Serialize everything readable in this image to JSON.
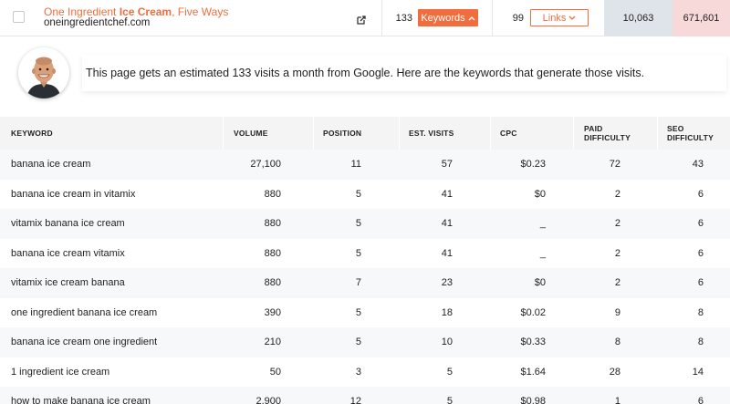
{
  "result": {
    "title_prefix": "One Ingredient ",
    "title_bold": "Ice Cream",
    "title_suffix": ", Five Ways",
    "domain": "oneingredientchef.com",
    "keyword_count": "133",
    "keywords_button": "Keywords",
    "backlink_count": "99",
    "links_button": "Links",
    "est_visits": "10,063",
    "shares": "671,601",
    "accent_color": "#f26d3d"
  },
  "banner": {
    "text": "This page gets an estimated 133 visits a month from Google. Here are the keywords that generate those visits."
  },
  "table": {
    "headers": {
      "keyword": "KEYWORD",
      "volume": "VOLUME",
      "position": "POSITION",
      "est_visits": "EST. VISITS",
      "cpc": "CPC",
      "paid_difficulty_1": "PAID",
      "paid_difficulty_2": "DIFFICULTY",
      "seo_difficulty_1": "SEO",
      "seo_difficulty_2": "DIFFICULTY"
    },
    "rows": [
      {
        "keyword": "banana ice cream",
        "volume": "27,100",
        "position": "11",
        "visits": "57",
        "cpc": "$0.23",
        "paid": "72",
        "seo": "43"
      },
      {
        "keyword": "banana ice cream in vitamix",
        "volume": "880",
        "position": "5",
        "visits": "41",
        "cpc": "$0",
        "paid": "2",
        "seo": "6"
      },
      {
        "keyword": "vitamix banana ice cream",
        "volume": "880",
        "position": "5",
        "visits": "41",
        "cpc": "_",
        "paid": "2",
        "seo": "6"
      },
      {
        "keyword": "banana ice cream vitamix",
        "volume": "880",
        "position": "5",
        "visits": "41",
        "cpc": "_",
        "paid": "2",
        "seo": "6"
      },
      {
        "keyword": "vitamix ice cream banana",
        "volume": "880",
        "position": "7",
        "visits": "23",
        "cpc": "$0",
        "paid": "2",
        "seo": "6"
      },
      {
        "keyword": "one ingredient banana ice cream",
        "volume": "390",
        "position": "5",
        "visits": "18",
        "cpc": "$0.02",
        "paid": "9",
        "seo": "8"
      },
      {
        "keyword": "banana ice cream one ingredient",
        "volume": "210",
        "position": "5",
        "visits": "10",
        "cpc": "$0.33",
        "paid": "8",
        "seo": "8"
      },
      {
        "keyword": "1 ingredient ice cream",
        "volume": "50",
        "position": "3",
        "visits": "5",
        "cpc": "$1.64",
        "paid": "28",
        "seo": "14"
      },
      {
        "keyword": "how to make banana ice cream",
        "volume": "2,900",
        "position": "12",
        "visits": "5",
        "cpc": "$0.98",
        "paid": "1",
        "seo": "6"
      }
    ]
  }
}
